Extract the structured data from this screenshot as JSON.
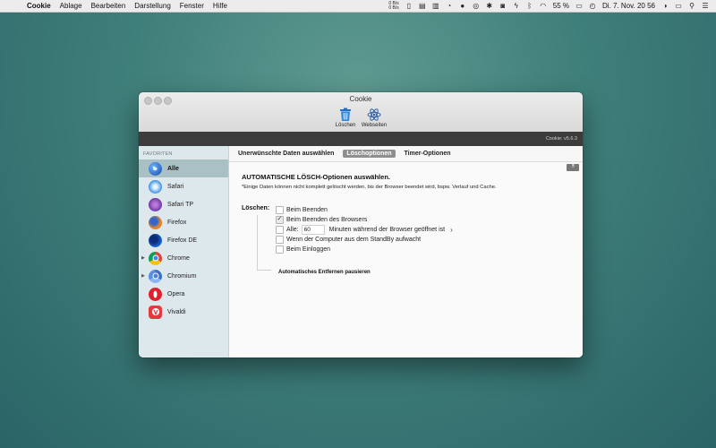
{
  "menubar": {
    "app": "Cookie",
    "items": [
      "Ablage",
      "Bearbeiten",
      "Darstellung",
      "Fenster",
      "Hilfe"
    ],
    "net_up": "0 B/s",
    "net_down": "0 B/s",
    "battery": "55 %",
    "clock": "Di. 7. Nov.  20 56"
  },
  "window": {
    "title": "Cookie",
    "toolbar": {
      "delete_label": "Löschen",
      "websites_label": "Webseiten"
    },
    "version": "Cookie: v5.6.3"
  },
  "sidebar": {
    "header": "FAVORITEN",
    "items": [
      {
        "label": "Alle",
        "selected": true,
        "icon": "globe-icon"
      },
      {
        "label": "Safari",
        "icon": "safari-icon"
      },
      {
        "label": "Safari TP",
        "icon": "safari-tp-icon"
      },
      {
        "label": "Firefox",
        "icon": "firefox-icon"
      },
      {
        "label": "Firefox DE",
        "icon": "firefox-de-icon"
      },
      {
        "label": "Chrome",
        "icon": "chrome-icon",
        "expandable": true
      },
      {
        "label": "Chromium",
        "icon": "chromium-icon",
        "expandable": true
      },
      {
        "label": "Opera",
        "icon": "opera-icon"
      },
      {
        "label": "Vivaldi",
        "icon": "vivaldi-icon"
      }
    ]
  },
  "tabs": [
    {
      "label": "Unerwünschte Daten auswählen"
    },
    {
      "label": "Löschoptionen",
      "active": true
    },
    {
      "label": "Timer-Optionen"
    }
  ],
  "pane": {
    "more_button": "!!!",
    "heading": "AUTOMATISCHE LÖSCH-Optionen auswählen.",
    "note": "*Einige Daten können nicht komplett gelöscht werden, bis der Browser beendet wird, bspw. Verlauf und Cache.",
    "delete_label": "Löschen:",
    "options": {
      "on_quit": "Beim Beenden",
      "on_browser_quit": "Beim Beenden des Browsers",
      "every_label": "Alle:",
      "every_value": "60",
      "every_suffix": "Minuten während der Browser geöffnet ist",
      "on_wake": "Wenn der Computer aus dem StandBy aufwacht",
      "on_login": "Beim Einloggen"
    },
    "pause_label": "Automatisches Entfernen pausieren"
  }
}
